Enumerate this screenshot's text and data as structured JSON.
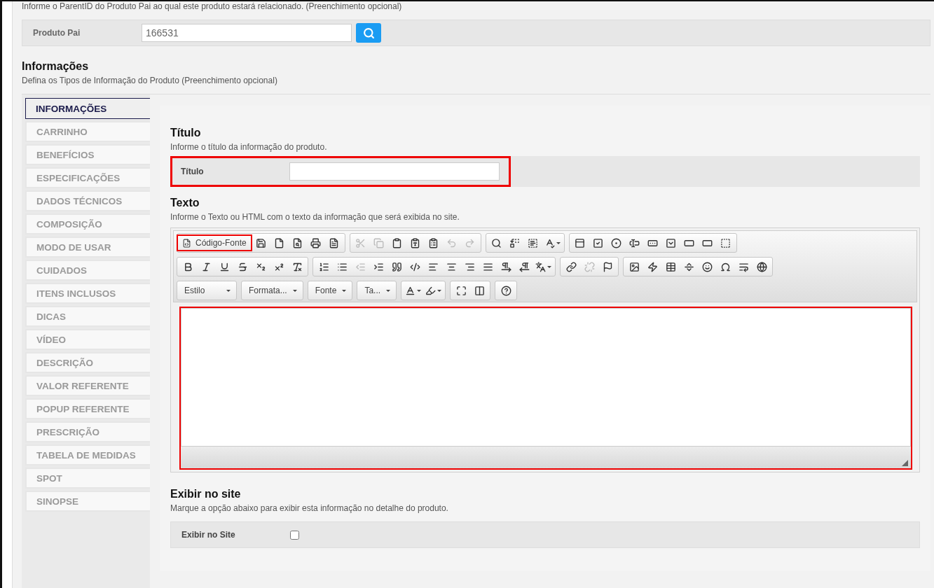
{
  "parent_section": {
    "description": "Informe o ParentID do Produto Pai ao qual este produto estará relacionado. (Preenchimento opcional)",
    "label": "Produto Pai",
    "value": "166531"
  },
  "info_section": {
    "title": "Informações",
    "description": "Defina os Tipos de Informação do Produto (Preenchimento opcional)"
  },
  "tabs": [
    {
      "label": "INFORMAÇÕES",
      "selected": true
    },
    {
      "label": "CARRINHO",
      "selected": false
    },
    {
      "label": "BENEFÍCIOS",
      "selected": false
    },
    {
      "label": "ESPECIFICAÇÕES",
      "selected": false
    },
    {
      "label": "DADOS TÉCNICOS",
      "selected": false
    },
    {
      "label": "COMPOSIÇÃO",
      "selected": false
    },
    {
      "label": "MODO DE USAR",
      "selected": false
    },
    {
      "label": "CUIDADOS",
      "selected": false
    },
    {
      "label": "ITENS INCLUSOS",
      "selected": false
    },
    {
      "label": "DICAS",
      "selected": false
    },
    {
      "label": "VÍDEO",
      "selected": false
    },
    {
      "label": "DESCRIÇÃO",
      "selected": false
    },
    {
      "label": "VALOR REFERENTE",
      "selected": false
    },
    {
      "label": "POPUP REFERENTE",
      "selected": false
    },
    {
      "label": "PRESCRIÇÃO",
      "selected": false
    },
    {
      "label": "TABELA DE MEDIDAS",
      "selected": false
    },
    {
      "label": "SPOT",
      "selected": false
    },
    {
      "label": "SINOPSE",
      "selected": false
    }
  ],
  "title_section": {
    "title": "Título",
    "description": "Informe o título da informação do produto.",
    "label": "Título",
    "highlighted": true
  },
  "text_section": {
    "title": "Texto",
    "description": "Informe o Texto ou HTML com o texto da informação que será exibida no site.",
    "editor_highlighted": true
  },
  "toolbar": [
    [
      [
        {
          "kind": "button",
          "label": "Código-Fonte",
          "highlighted": true
        },
        {
          "kind": "icon",
          "disabled": false
        },
        {
          "kind": "icon",
          "disabled": false
        },
        {
          "kind": "icon",
          "disabled": false
        },
        {
          "kind": "icon",
          "disabled": false
        },
        {
          "kind": "icon",
          "disabled": false
        }
      ],
      [
        {
          "kind": "icon",
          "disabled": true
        },
        {
          "kind": "icon",
          "disabled": true
        },
        {
          "kind": "icon",
          "disabled": false
        },
        {
          "kind": "icon",
          "disabled": false
        },
        {
          "kind": "icon",
          "disabled": false
        },
        {
          "kind": "icon",
          "disabled": true
        },
        {
          "kind": "icon",
          "disabled": true
        }
      ],
      [
        {
          "kind": "icon",
          "disabled": false
        },
        {
          "kind": "icon",
          "disabled": false
        },
        {
          "kind": "icon",
          "disabled": false
        },
        {
          "kind": "icon-menu",
          "disabled": false
        }
      ],
      [
        {
          "kind": "icon",
          "disabled": false
        },
        {
          "kind": "icon",
          "disabled": false
        },
        {
          "kind": "icon",
          "disabled": false
        },
        {
          "kind": "icon",
          "disabled": false
        },
        {
          "kind": "icon",
          "disabled": false
        },
        {
          "kind": "icon",
          "disabled": false
        },
        {
          "kind": "icon",
          "disabled": false
        },
        {
          "kind": "icon",
          "disabled": false
        },
        {
          "kind": "icon",
          "disabled": false
        }
      ]
    ],
    [
      [
        {
          "kind": "icon",
          "disabled": false
        },
        {
          "kind": "icon",
          "disabled": false
        },
        {
          "kind": "icon",
          "disabled": false
        },
        {
          "kind": "icon",
          "disabled": false
        },
        {
          "kind": "icon",
          "disabled": false
        },
        {
          "kind": "icon",
          "disabled": false
        },
        {
          "kind": "icon",
          "disabled": false
        }
      ],
      [
        {
          "kind": "icon",
          "disabled": false
        },
        {
          "kind": "icon",
          "disabled": false
        },
        {
          "kind": "icon",
          "disabled": true
        },
        {
          "kind": "icon",
          "disabled": false
        },
        {
          "kind": "icon",
          "disabled": false
        },
        {
          "kind": "icon",
          "disabled": false
        },
        {
          "kind": "icon",
          "disabled": false
        },
        {
          "kind": "icon",
          "disabled": false
        },
        {
          "kind": "icon",
          "disabled": false
        },
        {
          "kind": "icon",
          "disabled": false
        },
        {
          "kind": "icon",
          "disabled": false
        },
        {
          "kind": "icon",
          "disabled": false
        },
        {
          "kind": "icon-menu",
          "disabled": false
        }
      ],
      [
        {
          "kind": "icon",
          "disabled": false
        },
        {
          "kind": "icon",
          "disabled": true
        },
        {
          "kind": "icon",
          "disabled": false
        }
      ],
      [
        {
          "kind": "icon",
          "disabled": false
        },
        {
          "kind": "icon",
          "disabled": false
        },
        {
          "kind": "icon",
          "disabled": false
        },
        {
          "kind": "icon",
          "disabled": false
        },
        {
          "kind": "icon",
          "disabled": false
        },
        {
          "kind": "icon",
          "disabled": false
        },
        {
          "kind": "icon",
          "disabled": false
        },
        {
          "kind": "icon",
          "disabled": false
        }
      ]
    ],
    [
      [
        {
          "kind": "dropdown",
          "label": "Estilo"
        }
      ],
      [
        {
          "kind": "dropdown",
          "label": "Formata..."
        }
      ],
      [
        {
          "kind": "dropdown",
          "label": "Fonte"
        }
      ],
      [
        {
          "kind": "dropdown",
          "label": "Ta..."
        }
      ],
      [
        {
          "kind": "icon-menu",
          "disabled": false
        },
        {
          "kind": "icon-menu",
          "disabled": false
        }
      ],
      [
        {
          "kind": "icon",
          "disabled": false
        },
        {
          "kind": "icon",
          "disabled": false
        }
      ],
      [
        {
          "kind": "icon",
          "disabled": false
        }
      ]
    ]
  ],
  "show_section": {
    "title": "Exibir no site",
    "description": "Marque a opção abaixo para exibir esta informação no detalhe do produto.",
    "label": "Exibir no Site",
    "checked": false
  }
}
